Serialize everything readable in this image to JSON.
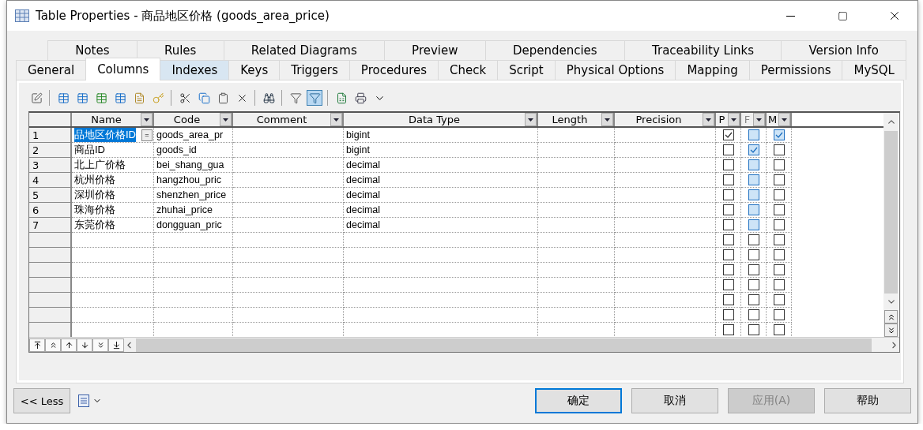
{
  "window": {
    "title": "Table Properties - 商品地区价格 (goods_area_price)"
  },
  "tab_rows": [
    [
      {
        "label": "Notes",
        "selected": false,
        "hover": false
      },
      {
        "label": "Rules",
        "selected": false,
        "hover": false
      },
      {
        "label": "Related Diagrams",
        "selected": false,
        "hover": false
      },
      {
        "label": "Preview",
        "selected": false,
        "hover": false
      },
      {
        "label": "Dependencies",
        "selected": false,
        "hover": false
      },
      {
        "label": "Traceability Links",
        "selected": false,
        "hover": false
      },
      {
        "label": "Version Info",
        "selected": false,
        "hover": false
      }
    ],
    [
      {
        "label": "General",
        "selected": false,
        "hover": false
      },
      {
        "label": "Columns",
        "selected": true,
        "hover": false
      },
      {
        "label": "Indexes",
        "selected": false,
        "hover": true
      },
      {
        "label": "Keys",
        "selected": false,
        "hover": false
      },
      {
        "label": "Triggers",
        "selected": false,
        "hover": false
      },
      {
        "label": "Procedures",
        "selected": false,
        "hover": false
      },
      {
        "label": "Check",
        "selected": false,
        "hover": false
      },
      {
        "label": "Script",
        "selected": false,
        "hover": false
      },
      {
        "label": "Physical Options",
        "selected": false,
        "hover": false
      },
      {
        "label": "Mapping",
        "selected": false,
        "hover": false
      },
      {
        "label": "Permissions",
        "selected": false,
        "hover": false
      },
      {
        "label": "MySQL",
        "selected": false,
        "hover": false
      }
    ]
  ],
  "toolbar": [
    [
      {
        "kind": "properties",
        "pressed": false
      }
    ],
    [
      {
        "kind": "insert-row",
        "pressed": false
      },
      {
        "kind": "add-row",
        "pressed": false
      },
      {
        "kind": "add-columns",
        "pressed": false
      },
      {
        "kind": "replicate",
        "pressed": false
      },
      {
        "kind": "new-doc",
        "pressed": false
      },
      {
        "kind": "new-key",
        "pressed": false
      }
    ],
    [
      {
        "kind": "cut",
        "pressed": false
      },
      {
        "kind": "copy",
        "pressed": false
      },
      {
        "kind": "paste",
        "pressed": false
      },
      {
        "kind": "delete",
        "pressed": false
      }
    ],
    [
      {
        "kind": "find",
        "pressed": false
      }
    ],
    [
      {
        "kind": "filter",
        "pressed": false
      },
      {
        "kind": "filter-check",
        "pressed": true
      }
    ],
    [
      {
        "kind": "excel",
        "pressed": false
      },
      {
        "kind": "print",
        "pressed": false
      },
      {
        "kind": "caret",
        "pressed": false
      }
    ]
  ],
  "table": {
    "columns": [
      {
        "label": "Name",
        "disabled": false
      },
      {
        "label": "Code",
        "disabled": false
      },
      {
        "label": "Comment",
        "disabled": false
      },
      {
        "label": "Data Type",
        "disabled": false
      },
      {
        "label": "Length",
        "disabled": false
      },
      {
        "label": "Precision",
        "disabled": false
      },
      {
        "label": "P",
        "disabled": false
      },
      {
        "label": "F",
        "disabled": true
      },
      {
        "label": "M",
        "disabled": false
      }
    ],
    "rows": [
      {
        "number": "1",
        "name": "品地区价格ID",
        "editor_button": "=",
        "code": "goods_area_pr",
        "data_type": "bigint",
        "selected": true,
        "p": {
          "checked": true,
          "color": "#333333"
        },
        "f": {
          "checked": false,
          "color": "#1e6fc0"
        },
        "m": {
          "checked": true,
          "color": "#1e6fc0"
        }
      },
      {
        "number": "2",
        "name": "商品ID",
        "code": "goods_id",
        "data_type": "bigint",
        "selected": false,
        "p": {
          "checked": false,
          "color": "#333333"
        },
        "f": {
          "checked": true,
          "color": "#1e6fc0"
        },
        "m": {
          "checked": false,
          "color": "#333333"
        }
      },
      {
        "number": "3",
        "name": "北上广价格",
        "code": "bei_shang_gua",
        "data_type": "decimal",
        "selected": false,
        "p": {
          "checked": false,
          "color": "#333333"
        },
        "f": {
          "checked": false,
          "color": "#1e6fc0"
        },
        "m": {
          "checked": false,
          "color": "#333333"
        }
      },
      {
        "number": "4",
        "name": "杭州价格",
        "code": "hangzhou_pric",
        "data_type": "decimal",
        "selected": false,
        "p": {
          "checked": false,
          "color": "#333333"
        },
        "f": {
          "checked": false,
          "color": "#1e6fc0"
        },
        "m": {
          "checked": false,
          "color": "#333333"
        }
      },
      {
        "number": "5",
        "name": "深圳价格",
        "code": "shenzhen_price",
        "data_type": "decimal",
        "selected": false,
        "p": {
          "checked": false,
          "color": "#333333"
        },
        "f": {
          "checked": false,
          "color": "#1e6fc0"
        },
        "m": {
          "checked": false,
          "color": "#333333"
        }
      },
      {
        "number": "6",
        "name": "珠海价格",
        "code": "zhuhai_price",
        "data_type": "decimal",
        "selected": false,
        "p": {
          "checked": false,
          "color": "#333333"
        },
        "f": {
          "checked": false,
          "color": "#1e6fc0"
        },
        "m": {
          "checked": false,
          "color": "#333333"
        }
      },
      {
        "number": "7",
        "name": "东莞价格",
        "code": "dongguan_pric",
        "data_type": "decimal",
        "selected": false,
        "p": {
          "checked": false,
          "color": "#333333"
        },
        "f": {
          "checked": false,
          "color": "#1e6fc0"
        },
        "m": {
          "checked": false,
          "color": "#333333"
        }
      },
      {
        "p": {
          "checked": false,
          "color": "#333333"
        },
        "f": {
          "checked": false,
          "color": "#333333"
        },
        "m": {
          "checked": false,
          "color": "#333333"
        }
      },
      {
        "p": {
          "checked": false,
          "color": "#333333"
        },
        "f": {
          "checked": false,
          "color": "#333333"
        },
        "m": {
          "checked": false,
          "color": "#333333"
        }
      },
      {
        "p": {
          "checked": false,
          "color": "#333333"
        },
        "f": {
          "checked": false,
          "color": "#333333"
        },
        "m": {
          "checked": false,
          "color": "#333333"
        }
      },
      {
        "p": {
          "checked": false,
          "color": "#333333"
        },
        "f": {
          "checked": false,
          "color": "#333333"
        },
        "m": {
          "checked": false,
          "color": "#333333"
        }
      },
      {
        "p": {
          "checked": false,
          "color": "#333333"
        },
        "f": {
          "checked": false,
          "color": "#333333"
        },
        "m": {
          "checked": false,
          "color": "#333333"
        }
      },
      {
        "p": {
          "checked": false,
          "color": "#333333"
        },
        "f": {
          "checked": false,
          "color": "#333333"
        },
        "m": {
          "checked": false,
          "color": "#333333"
        }
      },
      {
        "p": {
          "checked": false,
          "color": "#333333"
        },
        "f": {
          "checked": false,
          "color": "#333333"
        },
        "m": {
          "checked": false,
          "color": "#333333"
        }
      }
    ]
  },
  "less_button": "<< Less",
  "buttons": [
    {
      "label": "确定",
      "default": true,
      "disabled": false
    },
    {
      "label": "取消",
      "default": false,
      "disabled": false
    },
    {
      "label": "应用(A)",
      "default": false,
      "disabled": true
    },
    {
      "label": "帮助",
      "default": false,
      "disabled": false
    }
  ]
}
